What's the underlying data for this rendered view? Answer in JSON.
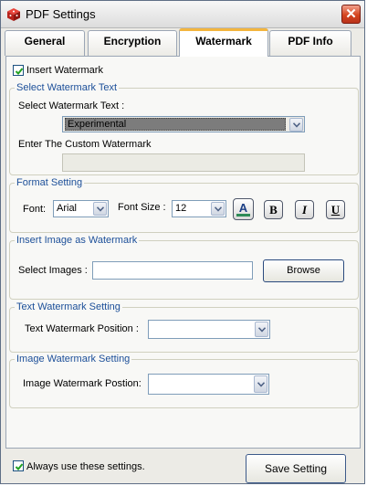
{
  "window": {
    "title": "PDF Settings",
    "app_icon": "red-cube-icon",
    "close_glyph": "✕"
  },
  "tabs": [
    {
      "label": "General",
      "active": false
    },
    {
      "label": "Encryption",
      "active": false
    },
    {
      "label": "Watermark",
      "active": true
    },
    {
      "label": "PDF Info",
      "active": false
    }
  ],
  "insert_watermark": {
    "label": "Insert Watermark",
    "checked": true
  },
  "watermark_text": {
    "group_title": "Select Watermark Text",
    "select_label": "Select Watermark Text :",
    "selected": "Experimental",
    "custom_label": "Enter The Custom Watermark",
    "custom_value": ""
  },
  "format": {
    "group_title": "Format Setting",
    "font_label": "Font:",
    "font_value": "Arial",
    "size_label": "Font Size :",
    "size_value": "12",
    "color_glyph": "A",
    "bold_glyph": "B",
    "italic_glyph": "I",
    "underline_glyph": "U",
    "color_accent": "#2e8b57"
  },
  "image_watermark": {
    "group_title": "Insert Image as Watermark",
    "select_label": "Select Images :",
    "path_value": "",
    "browse_label": "Browse"
  },
  "text_position": {
    "group_title": "Text Watermark Setting",
    "label": "Text Watermark Position :",
    "value": ""
  },
  "image_position": {
    "group_title": "Image Watermark Setting",
    "label": "Image Watermark Postion:",
    "value": ""
  },
  "footer": {
    "always_use_label": "Always use these settings.",
    "always_use_checked": true,
    "save_label": "Save Setting"
  }
}
